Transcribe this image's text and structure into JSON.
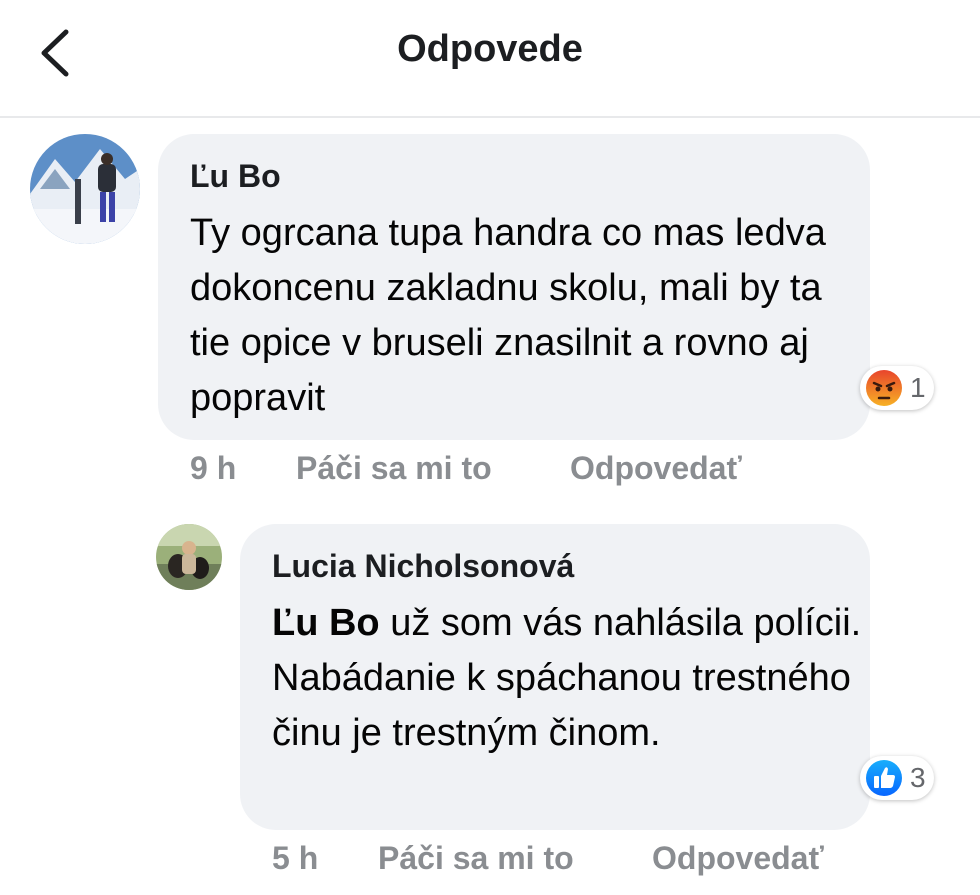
{
  "header": {
    "title": "Odpovede",
    "back_icon": "chevron-left-icon"
  },
  "comments": [
    {
      "author": "Ľu Bo",
      "text": "Ty ogrcana tupa handra co mas ledva dokoncenu zakladnu skolu, mali by ta tie opice v bruseli znasilnit a rovno aj popravit",
      "reaction": {
        "icon": "angry-reaction-icon",
        "count": "1",
        "color": "#f0772b"
      },
      "time": "9 h",
      "like_label": "Páči sa mi to",
      "reply_label": "Odpovedať"
    },
    {
      "author": "Lucia Nicholsonová",
      "mention": "Ľu Bo",
      "text": " už som vás nahlásila polícii. Nabádanie k spáchanou trestného činu je trestným činom.",
      "reaction": {
        "icon": "like-reaction-icon",
        "count": "3",
        "color": "#1877f2"
      },
      "time": "5 h",
      "like_label": "Páči sa mi to",
      "reply_label": "Odpovedať"
    }
  ]
}
